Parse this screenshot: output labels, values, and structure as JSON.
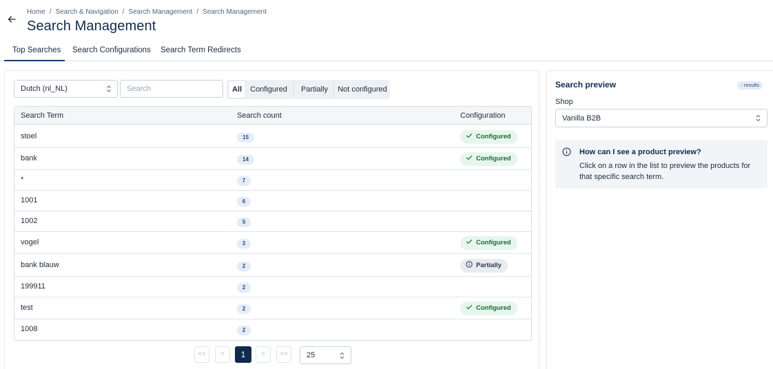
{
  "breadcrumb": [
    "Home",
    "Search & Navigation",
    "Search Management",
    "Search Management"
  ],
  "page_title": "Search Management",
  "tabs": [
    {
      "label": "Top Searches",
      "active": true
    },
    {
      "label": "Search Configurations",
      "active": false
    },
    {
      "label": "Search Term Redirects",
      "active": false
    }
  ],
  "filters": {
    "language": "Dutch (nl_NL)",
    "search_placeholder": "Search",
    "segments": [
      "All",
      "Configured",
      "Partially",
      "Not configured"
    ],
    "active_segment": "All"
  },
  "table": {
    "headers": {
      "term": "Search Term",
      "count": "Search count",
      "config": "Configuration"
    },
    "rows": [
      {
        "term": "stoel",
        "count": "15",
        "config": "Configured"
      },
      {
        "term": "bank",
        "count": "14",
        "config": "Configured"
      },
      {
        "term": "*",
        "count": "7",
        "config": ""
      },
      {
        "term": "1001",
        "count": "6",
        "config": ""
      },
      {
        "term": "1002",
        "count": "5",
        "config": ""
      },
      {
        "term": "vogel",
        "count": "3",
        "config": "Configured"
      },
      {
        "term": "bank blauw",
        "count": "2",
        "config": "Partially"
      },
      {
        "term": "199911",
        "count": "2",
        "config": ""
      },
      {
        "term": "test",
        "count": "2",
        "config": "Configured"
      },
      {
        "term": "1008",
        "count": "2",
        "config": ""
      }
    ]
  },
  "pagination": {
    "first": "<<",
    "prev": "<",
    "current": "1",
    "next": ">",
    "last": ">>",
    "page_size": "25"
  },
  "preview": {
    "title": "Search preview",
    "badge": "- results",
    "shop_label": "Shop",
    "shop_value": "Vanilla B2B",
    "info_title": "How can I see a product preview?",
    "info_text": "Click on a row in the list to preview the products for that specific search term."
  },
  "colors": {
    "primary": "#0f2b4d",
    "configured_bg": "#e7f6ec",
    "configured_text": "#1b6a3a",
    "partial_bg": "#e8ebef",
    "count_bg": "#e4ecf7"
  },
  "icons": {
    "back": "arrow-left-icon",
    "check": "check-icon",
    "info": "info-circle-icon",
    "select": "chevron-up-down-icon"
  }
}
